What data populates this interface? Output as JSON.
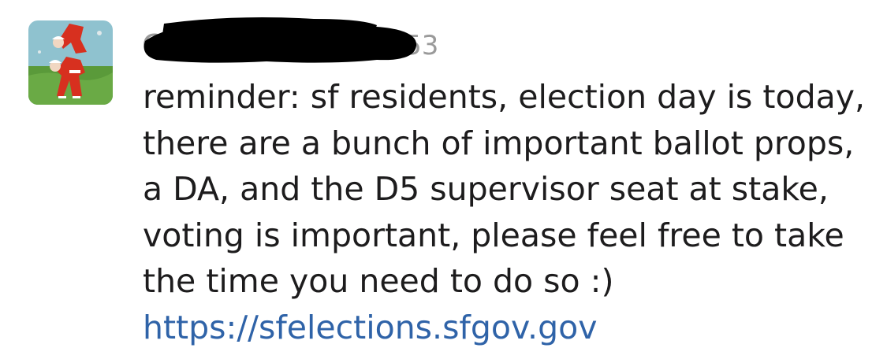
{
  "message": {
    "sender_name": "C",
    "timestamp": "6:53",
    "text": "reminder: sf residents, election day is today, there are a bunch of important ballot props, a DA, and the D5 supervisor seat at stake, voting is important, please feel free to take the time you need to do so :) ",
    "link": "https://sfelections.sfgov.gov",
    "avatar_icon": "profile-avatar-red-figures",
    "redaction_color": "#000000",
    "link_color": "#2f63a8"
  }
}
